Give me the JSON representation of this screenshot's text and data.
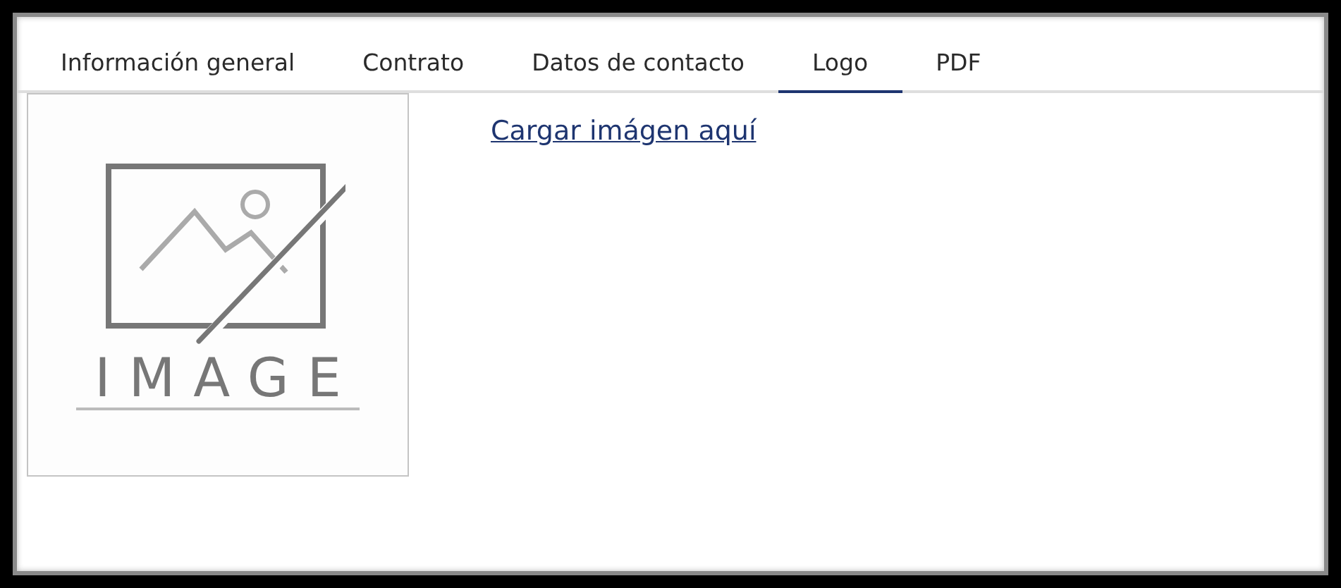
{
  "tabs": [
    {
      "label": "Información general",
      "selected": false
    },
    {
      "label": "Contrato",
      "selected": false
    },
    {
      "label": "Datos de contacto",
      "selected": false
    },
    {
      "label": "Logo",
      "selected": true
    },
    {
      "label": "PDF",
      "selected": false
    }
  ],
  "logo_preview": {
    "caption": "IMAGE"
  },
  "upload_link": "Cargar imágen aquí"
}
